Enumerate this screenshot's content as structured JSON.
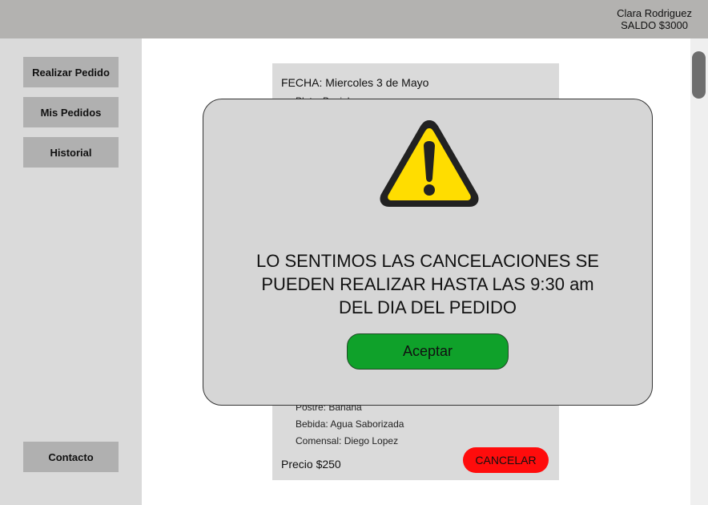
{
  "header": {
    "user_name": "Clara Rodriguez",
    "balance": "SALDO $3000"
  },
  "sidebar": {
    "items": [
      {
        "label": "Realizar Pedido"
      },
      {
        "label": "Mis Pedidos"
      },
      {
        "label": "Historial"
      }
    ],
    "contact_label": "Contacto"
  },
  "order": {
    "date": "FECHA:  Miercoles 3 de Mayo",
    "plate_partial": "Plato: Banjah",
    "dessert": "Postre: Banana",
    "drink": "Bebida: Agua Saborizada",
    "diner": "Comensal: Diego Lopez",
    "price": "Precio $250",
    "cancel_label": "CANCELAR"
  },
  "modal": {
    "icon": "warning-icon",
    "message_lines": [
      "LO SENTIMOS LAS CANCELACIONES SE",
      "PUEDEN REALIZAR HASTA LAS 9:30 am",
      "DEL DIA DEL PEDIDO"
    ],
    "accept_label": "Aceptar"
  },
  "colors": {
    "topbar": "#b3b2b0",
    "sidebar": "#dadada",
    "cancel": "#ff0c0c",
    "accept": "#0fa12a",
    "warning_yellow": "#ffdd00"
  }
}
